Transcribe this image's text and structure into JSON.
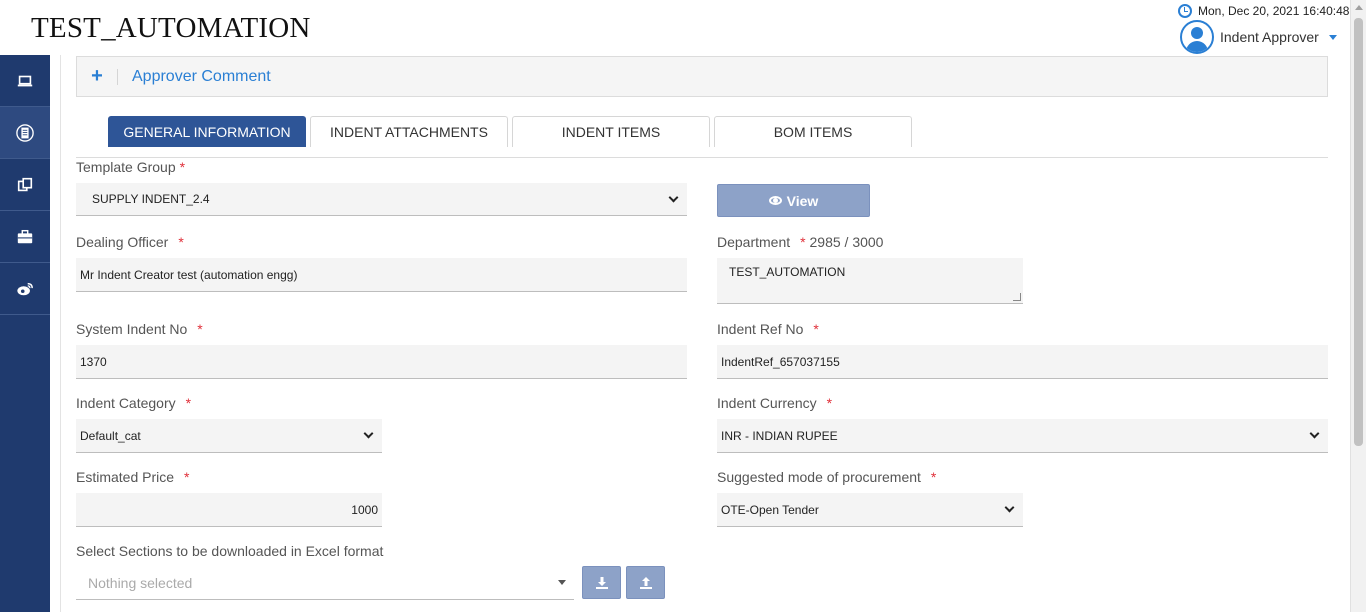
{
  "app": {
    "title": "TEST_AUTOMATION"
  },
  "header": {
    "datetime": "Mon, Dec 20, 2021 16:40:48",
    "user_name": "Indent Approver"
  },
  "sidebar": {
    "items": [
      {
        "icon": "laptop-icon"
      },
      {
        "icon": "document-icon"
      },
      {
        "icon": "copy-icon"
      },
      {
        "icon": "briefcase-icon"
      },
      {
        "icon": "weibo-icon"
      }
    ]
  },
  "approver_panel": {
    "toggle": "+",
    "title": "Approver Comment"
  },
  "tabs": [
    {
      "label": "GENERAL INFORMATION",
      "active": true
    },
    {
      "label": "INDENT ATTACHMENTS"
    },
    {
      "label": "INDENT ITEMS"
    },
    {
      "label": "BOM ITEMS"
    }
  ],
  "form": {
    "template_group": {
      "label": "Template Group",
      "required": "*",
      "value": "SUPPLY INDENT_2.4"
    },
    "view_button": {
      "label": "View"
    },
    "dealing_officer": {
      "label": "Dealing Officer",
      "required": "*",
      "value": "Mr Indent Creator test (automation engg)"
    },
    "department": {
      "label": "Department",
      "required": "*",
      "counter": "2985 / 3000",
      "value": "TEST_AUTOMATION"
    },
    "system_indent_no": {
      "label": "System Indent No",
      "required": "*",
      "value": "1370"
    },
    "indent_ref_no": {
      "label": "Indent Ref No",
      "required": "*",
      "value": "IndentRef_657037155"
    },
    "indent_category": {
      "label": "Indent Category",
      "required": "*",
      "value": "Default_cat"
    },
    "indent_currency": {
      "label": "Indent Currency",
      "required": "*",
      "value": "INR - INDIAN RUPEE"
    },
    "estimated_price": {
      "label": "Estimated Price",
      "required": "*",
      "value": "1000"
    },
    "procurement_mode": {
      "label": "Suggested mode of procurement",
      "required": "*",
      "value": "OTE-Open Tender"
    },
    "excel_sections": {
      "label": "Select Sections to be downloaded in Excel format",
      "placeholder": "Nothing selected"
    }
  },
  "colors": {
    "sidebar": "#1f3a6e",
    "accent": "#2a7fd4",
    "active_tab": "#2e5597",
    "button": "#8da2c8",
    "required": "#e0303a"
  }
}
